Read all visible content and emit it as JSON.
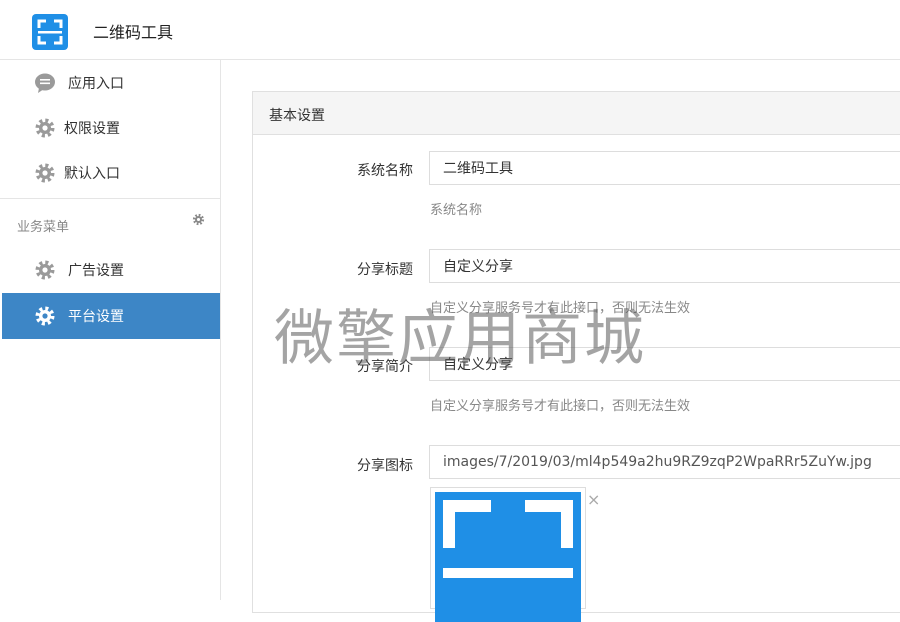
{
  "app": {
    "title": "二维码工具"
  },
  "sidebar": {
    "items": [
      {
        "label": "应用入口",
        "icon": "chat-bubble-icon"
      },
      {
        "label": "权限设置",
        "icon": "gear-icon"
      },
      {
        "label": "默认入口",
        "icon": "gear-icon"
      }
    ],
    "section": {
      "label": "业务菜单",
      "icon": "gear-icon"
    },
    "section_items": [
      {
        "label": "广告设置",
        "icon": "gear-icon",
        "active": false
      },
      {
        "label": "平台设置",
        "icon": "gear-icon",
        "active": true
      }
    ]
  },
  "panel": {
    "title": "基本设置",
    "fields": [
      {
        "label": "系统名称",
        "value": "二维码工具",
        "help": "系统名称"
      },
      {
        "label": "分享标题",
        "value": "自定义分享",
        "help": "自定义分享服务号才有此接口，否则无法生效"
      },
      {
        "label": "分享简介",
        "value": "自定义分享",
        "help": "自定义分享服务号才有此接口，否则无法生效"
      },
      {
        "label": "分享图标",
        "value": "images/7/2019/03/ml4p549a2hu9RZ9zqP2WpaRRr5ZuYw.jpg"
      }
    ],
    "remove_symbol": "×"
  },
  "watermark": "微擎应用商城",
  "colors": {
    "active": "#3d86c6",
    "icon_blue": "#1f8fe6",
    "icon_gray": "#9a9a9a"
  }
}
